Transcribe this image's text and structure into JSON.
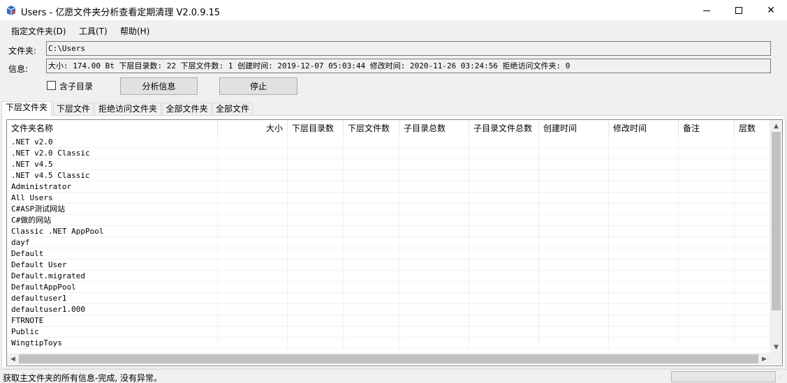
{
  "window": {
    "title": "Users - 亿愿文件夹分析查看定期清理 V2.0.9.15",
    "minimize_glyph": "",
    "maximize_glyph": "",
    "close_glyph": "✕"
  },
  "menu": [
    {
      "label": "指定文件夹(D)"
    },
    {
      "label": "工具(T)"
    },
    {
      "label": "帮助(H)"
    }
  ],
  "form": {
    "folder_label": "文件夹:",
    "folder_value": "C:\\Users",
    "info_label": "信息:",
    "info_value": "大小: 174.00 Bt 下层目录数: 22 下层文件数: 1 创建时间: 2019-12-07 05:03:44 修改时间: 2020-11-26 03:24:56 拒绝访问文件夹: 0",
    "include_subdirs_label": "含子目录",
    "include_subdirs_checked": false,
    "analyze_button": "分析信息",
    "stop_button": "停止"
  },
  "tabs": [
    {
      "label": "下层文件夹",
      "active": true
    },
    {
      "label": "下层文件",
      "active": false
    },
    {
      "label": "拒绝访问文件夹",
      "active": false
    },
    {
      "label": "全部文件夹",
      "active": false
    },
    {
      "label": "全部文件",
      "active": false
    }
  ],
  "table": {
    "columns": [
      "文件夹名称",
      "大小",
      "下层目录数",
      "下层文件数",
      "子目录总数",
      "子目录文件总数",
      "创建时间",
      "修改时间",
      "备注",
      "层数"
    ],
    "rows": [
      ".NET v2.0",
      ".NET v2.0 Classic",
      ".NET v4.5",
      ".NET v4.5 Classic",
      "Administrator",
      "All Users",
      "C#ASP测试网站",
      "C#做的网站",
      "Classic .NET AppPool",
      "dayf",
      "Default",
      "Default User",
      "Default.migrated",
      "DefaultAppPool",
      "defaultuser1",
      "defaultuser1.000",
      "FTRNOTE",
      "Public",
      "WingtipToys"
    ]
  },
  "scroll": {
    "up": "▲",
    "down": "▼",
    "left": "◀",
    "right": "▶"
  },
  "status": {
    "text": "获取主文件夹的所有信息-完成, 没有异常。"
  },
  "colors": {
    "window_bg": "#f0f0f0",
    "list_bg": "#ffffff",
    "button_bg": "#e1e1e1"
  }
}
